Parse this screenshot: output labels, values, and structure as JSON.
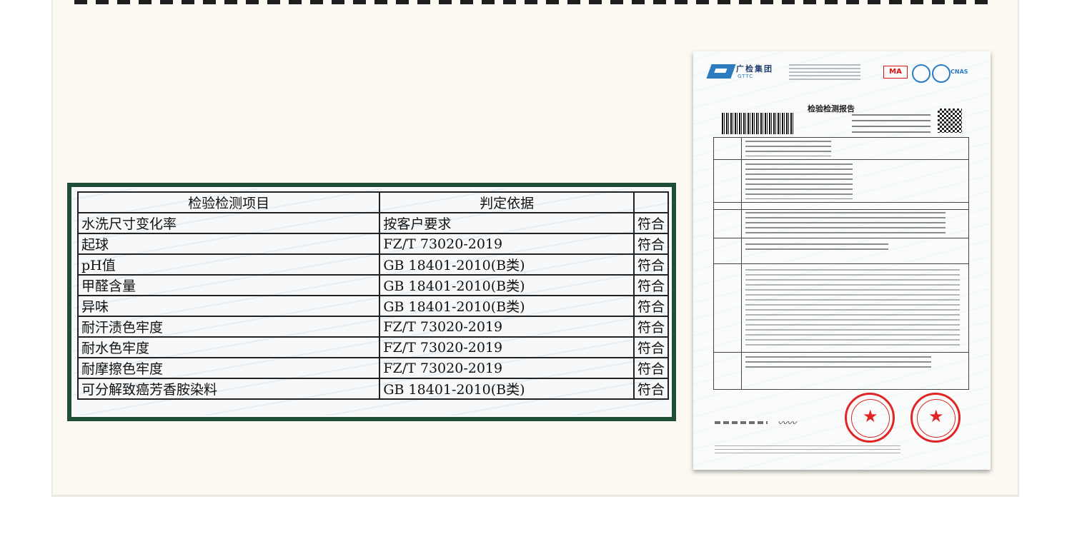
{
  "table": {
    "headers": [
      "检验检测项目",
      "判定依据",
      ""
    ],
    "rows": [
      [
        "水洗尺寸变化率",
        "按客户要求",
        "符合"
      ],
      [
        "起球",
        "FZ/T 73020-2019",
        "符合"
      ],
      [
        "pH值",
        "GB 18401-2010(B类)",
        "符合"
      ],
      [
        "甲醛含量",
        "GB 18401-2010(B类)",
        "符合"
      ],
      [
        "异味",
        "GB 18401-2010(B类)",
        "符合"
      ],
      [
        "耐汗渍色牢度",
        "FZ/T 73020-2019",
        "符合"
      ],
      [
        "耐水色牢度",
        "FZ/T 73020-2019",
        "符合"
      ],
      [
        "耐摩擦色牢度",
        "FZ/T 73020-2019",
        "符合"
      ],
      [
        "可分解致癌芳香胺染料",
        "GB 18401-2010(B类)",
        "符合"
      ]
    ]
  },
  "certificate": {
    "org_name": "广检集团",
    "org_abbr": "GTTC",
    "ma_mark": "MA",
    "cnas_mark": "CNAS",
    "title": "检验检测报告"
  },
  "colors": {
    "frame": "#1f4d35",
    "stamp": "#e02525",
    "brand": "#2d7cc0"
  }
}
